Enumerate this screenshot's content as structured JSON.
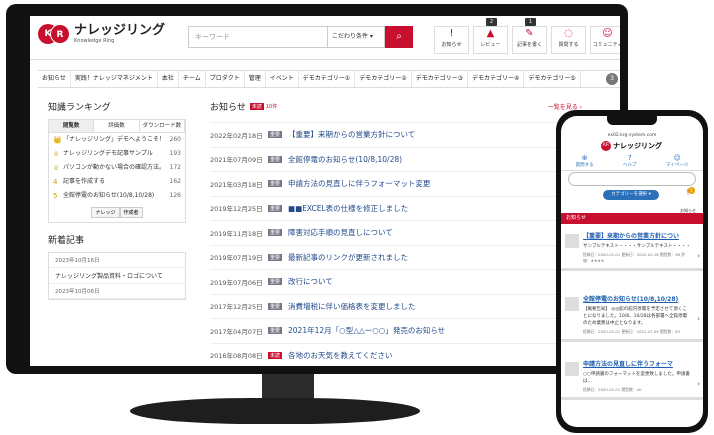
{
  "header": {
    "logo_title": "ナレッジリング",
    "logo_sub": "Knowledge Ring",
    "search_placeholder": "キーワード",
    "condition": "こだわり条件 ▾",
    "search_icon": "search-icon"
  },
  "header_icons": [
    {
      "glyph": "!",
      "label": "お知らせ",
      "badge": ""
    },
    {
      "glyph": "▲",
      "label": "レビュー",
      "badge": "2"
    },
    {
      "glyph": "✎",
      "label": "記事を書く",
      "badge": "1"
    },
    {
      "glyph": "◌",
      "label": "質問する",
      "badge": ""
    },
    {
      "glyph": "☺",
      "label": "コミュニティ",
      "badge": ""
    }
  ],
  "nav": [
    "お知らせ",
    "実践！ナレッジマネジメント",
    "本社",
    "チーム",
    "プロダクト",
    "管理",
    "イベント",
    "デモカテゴリー①",
    "デモカテゴリー②",
    "デモカテゴリー③",
    "デモカテゴリー④",
    "デモカテゴリー⑤"
  ],
  "nav_more": "3",
  "ranking": {
    "title": "知識ランキング",
    "tabs": [
      "閲覧数",
      "評価数",
      "ダウンロード数"
    ],
    "rows": [
      {
        "icon": "👑",
        "text": "「ナレッジリング」デモへようこそ！",
        "count": "260"
      },
      {
        "icon": "♕",
        "text": "ナレッジリングデモ記事サンプル",
        "count": "193"
      },
      {
        "icon": "♕",
        "text": "パソコンが動かない場合の確認方法。",
        "count": "172"
      },
      {
        "icon": "4",
        "text": "記事を作成する",
        "count": "162"
      },
      {
        "icon": "5",
        "text": "全館停電のお知らせ(10/8,10/28)",
        "count": "126"
      }
    ],
    "tags": [
      "ナレッジ",
      "作成者"
    ]
  },
  "new_articles": {
    "title": "新着記事",
    "items": [
      {
        "date": "2023年10月16日",
        "text": "ナレッジリング製品資料・ロゴについて"
      },
      {
        "date": "2023年10月06日",
        "text": ""
      }
    ]
  },
  "notices": {
    "title": "お知らせ",
    "badge": "未読",
    "count": "10件",
    "more": "一覧を見る ›",
    "items": [
      {
        "date": "2022年02月18日",
        "tag": "重要",
        "text": "【重要】来期からの営業方針について"
      },
      {
        "date": "2021年07月09日",
        "tag": "重要",
        "text": "全館停電のお知らせ(10/8,10/28)"
      },
      {
        "date": "2021年03月18日",
        "tag": "重要",
        "text": "申請方法の見直しに伴うフォーマット変更"
      },
      {
        "date": "2019年12月25日",
        "tag": "重要",
        "text": "■■EXCEL表の仕様を修正しました"
      },
      {
        "date": "2019年11月18日",
        "tag": "重要",
        "text": "障害対応手順の見直しについて"
      },
      {
        "date": "2019年07月19日",
        "tag": "重要",
        "text": "最新記事のリンクが更新されました"
      },
      {
        "date": "2019年07月06日",
        "tag": "重要",
        "text": "改行について"
      },
      {
        "date": "2017年12月25日",
        "tag": "重要",
        "text": "消費増税に伴い価格表を変更しました"
      },
      {
        "date": "2017年04月07日",
        "tag": "重要",
        "text": "2021年12月「○型△△ー○○」発売のお知らせ"
      },
      {
        "date": "2016年08月08日",
        "tag": "未読",
        "text": "各地のお天気を教えてください"
      }
    ]
  },
  "phone": {
    "url": "ex02.krg-system.com",
    "logo": "ナレッジリング",
    "nav": [
      {
        "glyph": "⊕",
        "label": "質問する"
      },
      {
        "glyph": "?",
        "label": "ヘルプ"
      },
      {
        "glyph": "☺",
        "label": "マイページ"
      }
    ],
    "category": "カテゴリーを選択 ▾",
    "bell_count": "1",
    "bell_label": "お知らせ",
    "bar": "お知らせ",
    "cards": [
      {
        "title": "【重要】来期からの営業方針につい",
        "body": "サンプルテキスト・・・・サンプルテキスト・・・・",
        "meta": "投稿日：2020-01-01 更新日：2022-02-18 閲覧数：98 評価：★★★★"
      },
      {
        "title": "全館停電のお知らせ(10/8,10/28)",
        "body": "【概要告知】 ◎◎館の館内停電を予定させて頂くことになりました。10/8、10/28は各部署へ全館停電のため業務は中止となります。",
        "meta": "投稿日：2020-01-01 更新日：2021-07-09 閲覧数：63"
      },
      {
        "title": "申請方法の見直しに伴うフォーマ",
        "body": "○○申請書のフォーマットを変更致しました。申請書は…",
        "meta": "投稿日：2020-01-01 閲覧数：40"
      }
    ]
  }
}
